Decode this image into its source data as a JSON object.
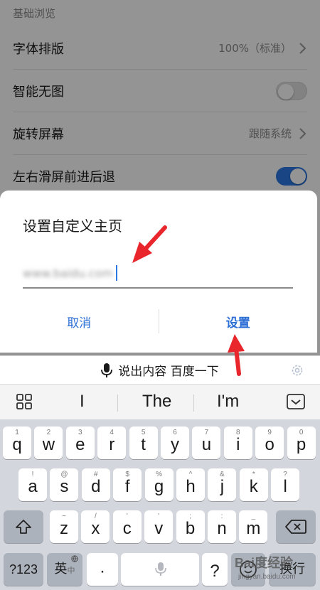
{
  "settings": {
    "section_header": "基础浏览",
    "rows": [
      {
        "label": "字体排版",
        "value": "100%（标准）"
      },
      {
        "label": "智能无图",
        "toggle": "off"
      },
      {
        "label": "旋转屏幕",
        "value": "跟随系统"
      },
      {
        "label": "左右滑屏前进后退",
        "toggle": "on"
      }
    ]
  },
  "dialog": {
    "title": "设置自定义主页",
    "input_value": "www.baidu.com",
    "cancel_label": "取消",
    "confirm_label": "设置"
  },
  "keyboard": {
    "voice_bar_text": "说出内容 百度一下",
    "suggestions": [
      "I",
      "The",
      "I'm"
    ],
    "row1": [
      {
        "key": "q",
        "hint": "1"
      },
      {
        "key": "w",
        "hint": "2"
      },
      {
        "key": "e",
        "hint": "3"
      },
      {
        "key": "r",
        "hint": "4"
      },
      {
        "key": "t",
        "hint": "5"
      },
      {
        "key": "y",
        "hint": "6"
      },
      {
        "key": "u",
        "hint": "7"
      },
      {
        "key": "i",
        "hint": "8"
      },
      {
        "key": "o",
        "hint": "9"
      },
      {
        "key": "p",
        "hint": "0"
      }
    ],
    "row2": [
      {
        "key": "a",
        "hint": "!"
      },
      {
        "key": "s",
        "hint": "@"
      },
      {
        "key": "d",
        "hint": "#"
      },
      {
        "key": "f",
        "hint": "$"
      },
      {
        "key": "g",
        "hint": "%"
      },
      {
        "key": "h",
        "hint": "^"
      },
      {
        "key": "j",
        "hint": "&"
      },
      {
        "key": "k",
        "hint": "*"
      },
      {
        "key": "l",
        "hint": "?"
      }
    ],
    "row3": [
      {
        "key": "z",
        "hint": "~"
      },
      {
        "key": "x",
        "hint": "/"
      },
      {
        "key": "c",
        "hint": "'"
      },
      {
        "key": "v",
        "hint": "'"
      },
      {
        "key": "b",
        "hint": ";"
      },
      {
        "key": "n",
        "hint": ":"
      },
      {
        "key": "m",
        "hint": "_"
      }
    ],
    "num_key": "?123",
    "lang_key": "英",
    "lang_key_sub": "中",
    "dot_key": "·",
    "question_key": "?",
    "enter_key": "换行"
  },
  "watermark": {
    "brand": "Bai度经验",
    "url": "jingyan.baidu.com"
  },
  "colors": {
    "accent": "#2b78e4",
    "annotation_arrow": "#e8262b"
  }
}
